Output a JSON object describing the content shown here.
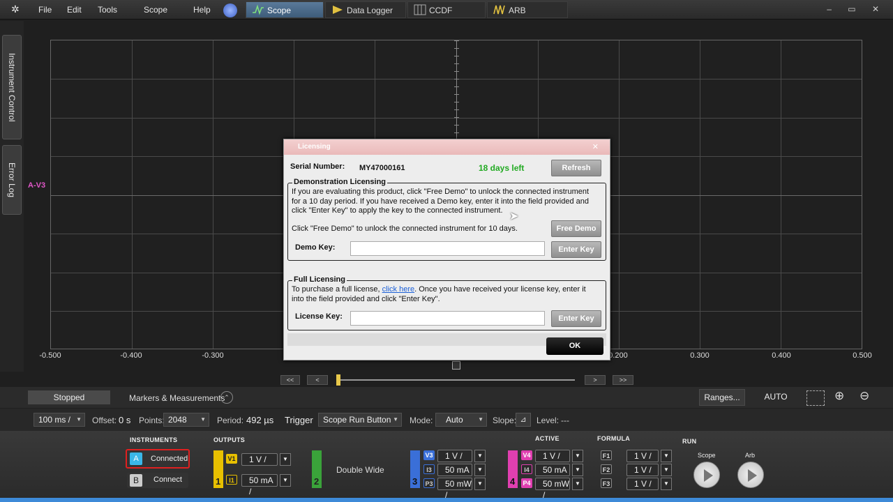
{
  "menu": {
    "file": "File",
    "edit": "Edit",
    "tools": "Tools",
    "scope": "Scope",
    "help": "Help"
  },
  "tabs": [
    {
      "label": "Scope"
    },
    {
      "label": "Data Logger"
    },
    {
      "label": "CCDF"
    },
    {
      "label": "ARB"
    }
  ],
  "window_controls": "– ▭ ✕",
  "sidebar": {
    "instrument_control": "Instrument Control",
    "error_log": "Error Log"
  },
  "plot": {
    "x_ticks": [
      "-0.500",
      "-0.400",
      "-0.300",
      "0.200",
      "0.300",
      "0.400",
      "0.500"
    ],
    "channel_marker": "A-V3"
  },
  "navigation": {
    "first": "<<",
    "prev": "<",
    "next": ">",
    "last": ">>"
  },
  "status": {
    "stopped": "Stopped",
    "markers": "Markers & Measurements",
    "ranges": "Ranges...",
    "auto_scale": "AUTO SCALE"
  },
  "settings": {
    "timebase": "100 ms /",
    "offset_label": "Offset:",
    "offset_value": "0 s",
    "points_label": "Points:",
    "points_value": "2048",
    "period_label": "Period:",
    "period_value": "492 µs",
    "trigger_label": "Trigger",
    "trigger_value": "Scope Run Button",
    "mode_label": "Mode:",
    "mode_value": "Auto",
    "slope_label": "Slope:",
    "level_label": "Level:",
    "level_value": "---"
  },
  "panel": {
    "instruments_title": "INSTRUMENTS",
    "outputs_title": "OUTPUTS",
    "active_title": "ACTIVE",
    "formula_title": "FORMULA",
    "run_title": "RUN",
    "inst_a_letter": "A",
    "inst_a_status": "Connected",
    "inst_b_letter": "B",
    "inst_b_status": "Connect",
    "ch1": {
      "num": "1",
      "v_tag": "V1",
      "v_val": "1 V /",
      "i_tag": "I1",
      "i_val": "50 mA /"
    },
    "ch2": {
      "num": "2",
      "label": "Double Wide"
    },
    "ch3": {
      "num": "3",
      "v_tag": "V3",
      "v_val": "1 V /",
      "i_tag": "I3",
      "i_val": "50 mA /",
      "p_tag": "P3",
      "p_val": "50 mW /"
    },
    "ch4": {
      "num": "4",
      "v_tag": "V4",
      "v_val": "1 V /",
      "i_tag": "I4",
      "i_val": "50 mA /",
      "p_tag": "P4",
      "p_val": "50 mW /"
    },
    "formula": {
      "f1": "F1",
      "f1_val": "1 V /",
      "f2": "F2",
      "f2_val": "1 V /",
      "f3": "F3",
      "f3_val": "1 V /"
    },
    "run_scope": "Scope",
    "run_arb": "Arb"
  },
  "dialog": {
    "title": "Licensing",
    "serial_label": "Serial Number:",
    "serial_value": "MY47000161",
    "days_left": "18 days left",
    "refresh": "Refresh",
    "demo_title": "Demonstration Licensing",
    "demo_text_1": "If you are evaluating this product, click \"Free Demo\" to unlock the connected instrument",
    "demo_text_2": "for a 10 day period. If you have received a Demo key, enter it into the field provided and",
    "demo_text_3": "click \"Enter Key\" to apply the key to the connected instrument.",
    "demo_text_4": "Click \"Free Demo\" to unlock the connected instrument for 10 days.",
    "free_demo": "Free Demo",
    "demo_key_label": "Demo Key:",
    "enter_key": "Enter Key",
    "full_title": "Full Licensing",
    "full_text_1a": "To purchase a full license, ",
    "full_link": "click here",
    "full_text_1b": ". Once you have received your license key, enter it",
    "full_text_2": "into the field provided and click \"Enter Key\".",
    "license_key_label": "License Key:",
    "enter_key_2": "Enter Key",
    "ok": "OK"
  },
  "colors": {
    "ch1": "#e8c000",
    "ch2": "#3aa33a",
    "ch3": "#3a6fd8",
    "ch4": "#e03fb0",
    "accent": "#3d8ad8",
    "days_left": "#22aa22"
  }
}
